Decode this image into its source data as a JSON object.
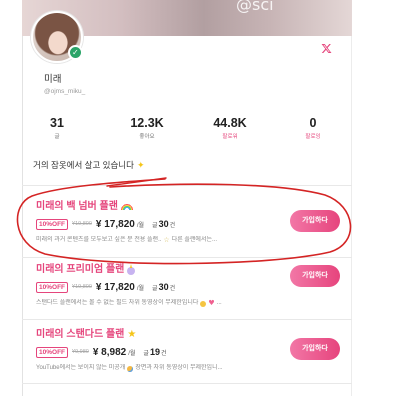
{
  "cover": {
    "watermark": "@sci"
  },
  "profile": {
    "name": "미래",
    "handle": "@ojms_miku_",
    "bio": "거의 잠옷에서 살고 있습니다",
    "bio_icon": "sparkle-icon",
    "verified_icon": "verified-check-icon",
    "social_icon": "x-icon"
  },
  "stats": [
    {
      "value": "31",
      "label": "글"
    },
    {
      "value": "12.3K",
      "label": "좋아요"
    },
    {
      "value": "44.8K",
      "label": "팔로워"
    },
    {
      "value": "0",
      "label": "팔로잉"
    }
  ],
  "plans": [
    {
      "title": "미래의 백 넘버 플랜",
      "title_icon": "rainbow-icon",
      "discount": "10%OFF",
      "original_price": "¥19,800",
      "price": "¥ 17,820",
      "period": "/월",
      "count_prefix": "글",
      "count": "30",
      "count_suffix": "건",
      "desc_before": "미래의 과거 콘텐츠를 모두보고 싶은 분 전용 플랜..",
      "desc_icons": [
        "star-outline-icon"
      ],
      "desc_after": "다른 플랜에서는...",
      "button": "가입하다"
    },
    {
      "title": "미래의 프리미엄 플랜",
      "title_icon": "unicorn-icon",
      "discount": "10%OFF",
      "original_price": "¥19,800",
      "price": "¥ 17,820",
      "period": "/월",
      "count_prefix": "글",
      "count": "30",
      "count_suffix": "건",
      "desc_before": "스탠다드 플랜에서는 볼 수 없는 필드 자위 동영상이 무제한입니다",
      "desc_icons": [
        "smiling-face-icon",
        "heart-icon"
      ],
      "desc_after": "...",
      "button": "가입하다"
    },
    {
      "title": "미래의 스탠다드 플랜",
      "title_icon": "glowing-star-icon",
      "discount": "10%OFF",
      "original_price": "¥9,980",
      "price": "¥ 8,982",
      "period": "/월",
      "count_prefix": "글",
      "count": "19",
      "count_suffix": "건",
      "desc_before": "YouTube에서는 보이지 않는 미공개",
      "desc_icons": [
        "crying-face-icon"
      ],
      "desc_after": "장면과 자위 동영상이 무제한입니...",
      "button": "가입하다"
    }
  ],
  "colors": {
    "accent": "#e5457c",
    "verified": "#2aa468",
    "annotation": "#d42424",
    "text": "#222222",
    "muted": "#8a8a8a"
  }
}
